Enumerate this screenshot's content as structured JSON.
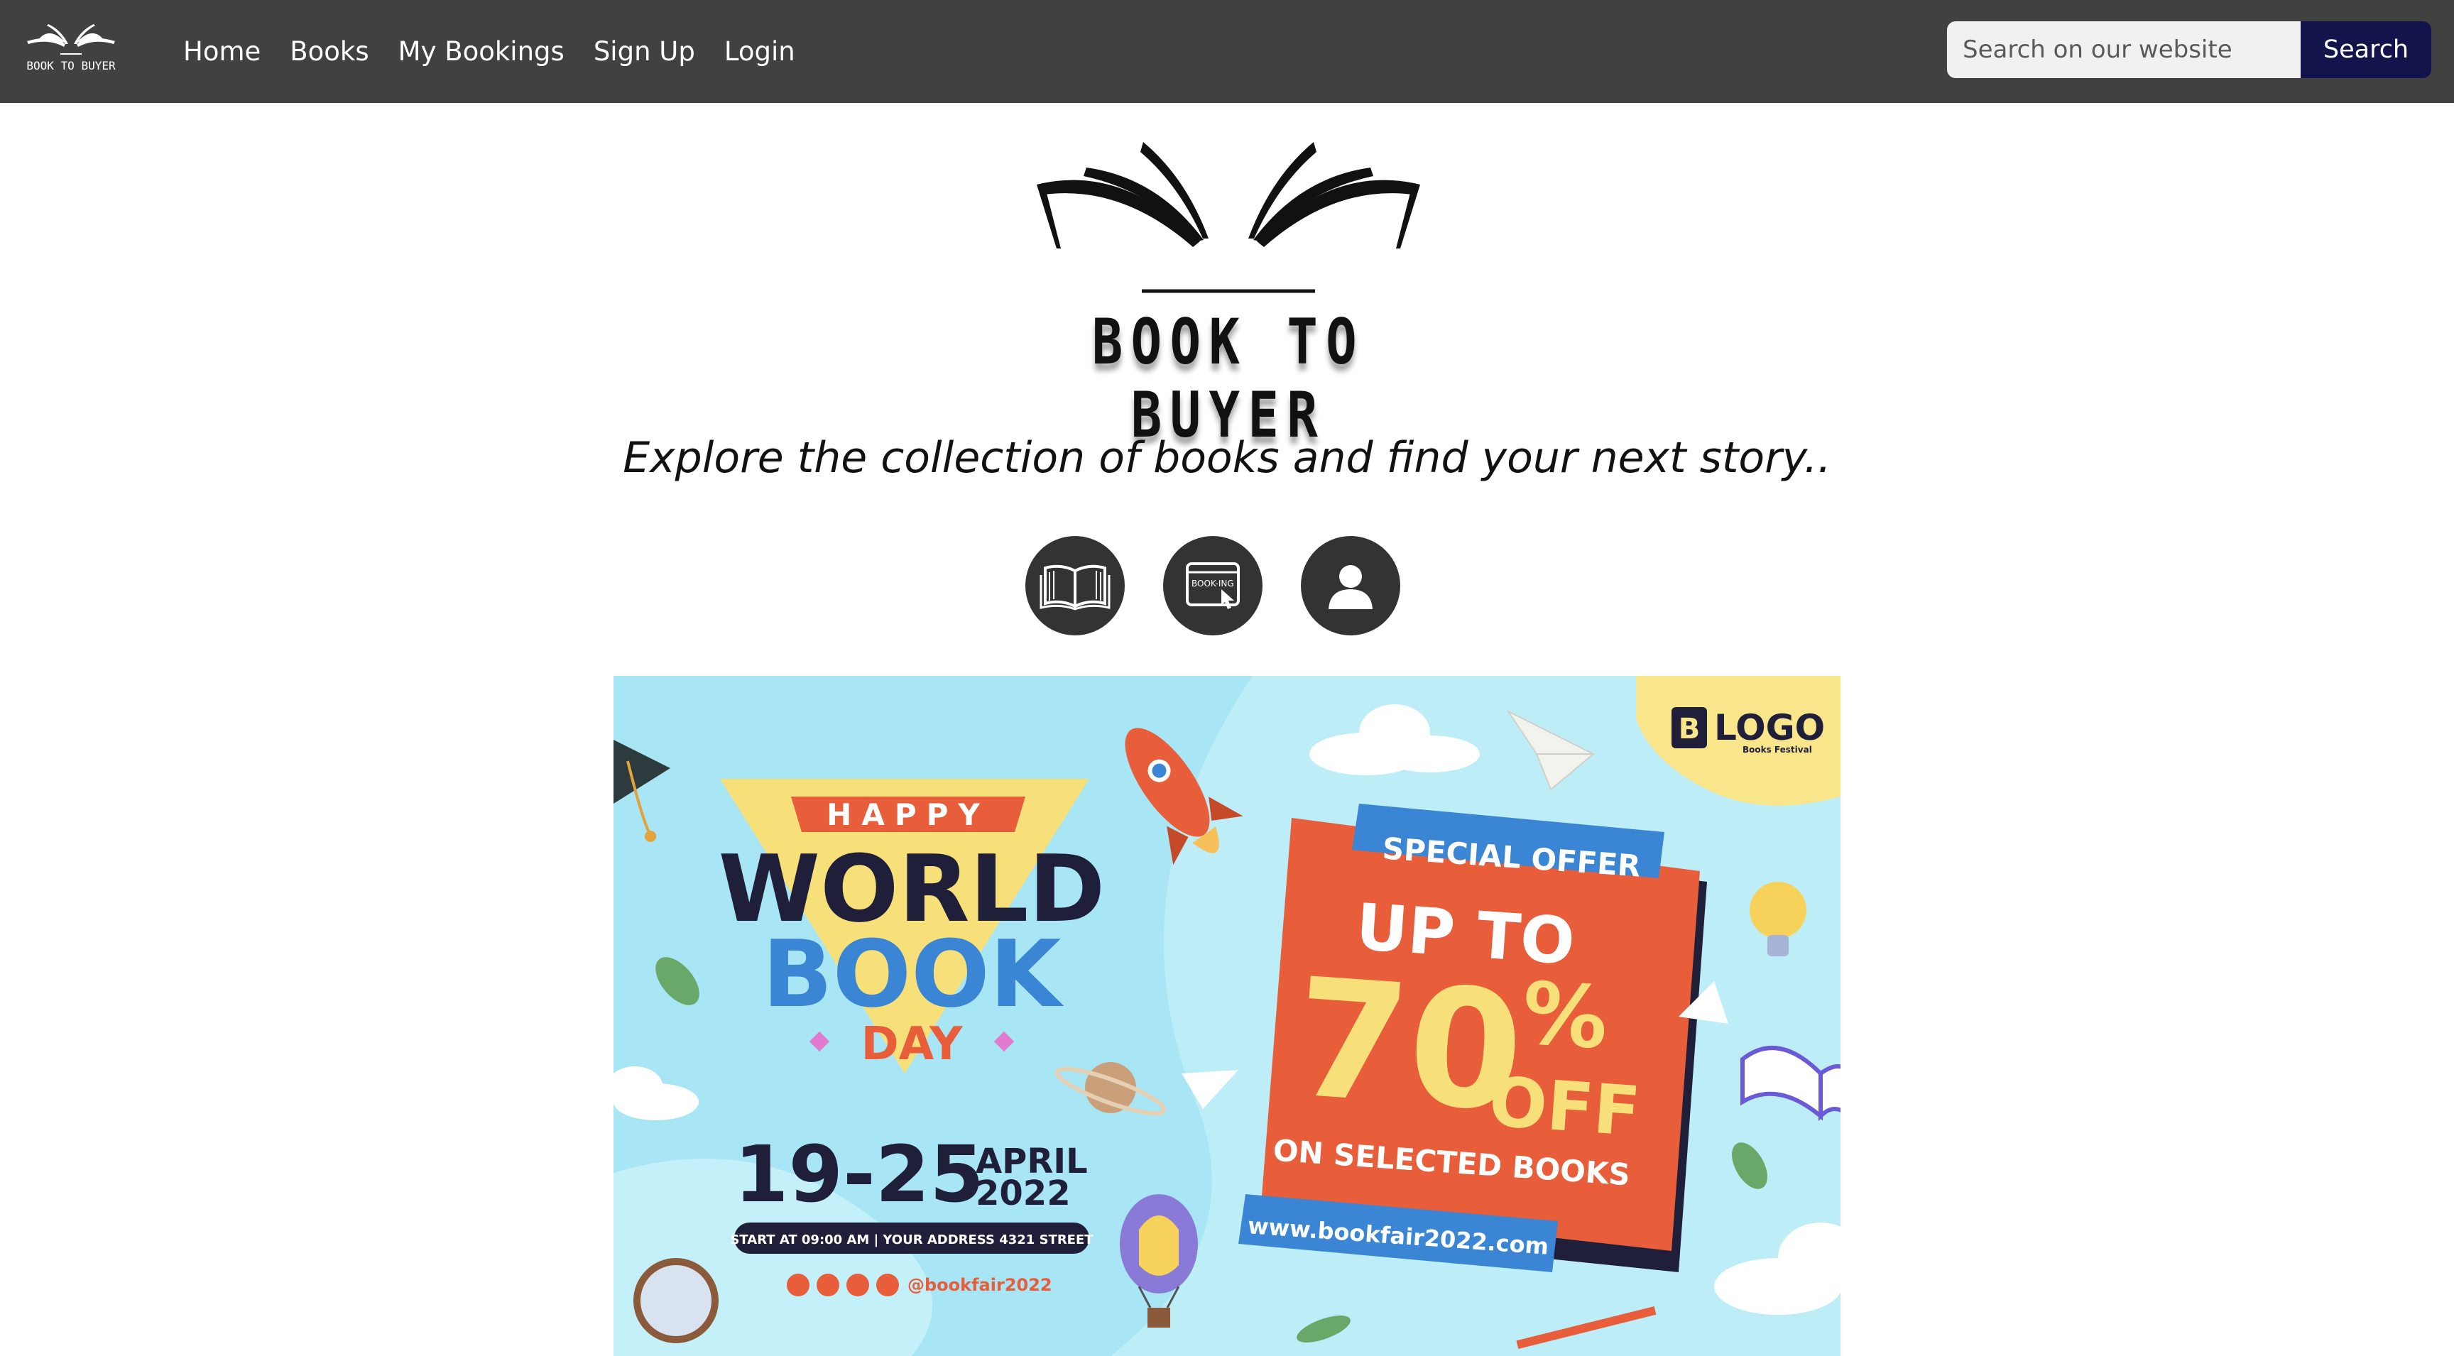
{
  "brand": {
    "name": "BOOK TO BUYER",
    "logo_text": "BOOK TO BUYER"
  },
  "nav": {
    "items": [
      {
        "label": "Home"
      },
      {
        "label": "Books"
      },
      {
        "label": "My Bookings"
      },
      {
        "label": "Sign Up"
      },
      {
        "label": "Login"
      }
    ]
  },
  "search": {
    "placeholder": "Search on our website",
    "value": "",
    "button_label": "Search"
  },
  "hero": {
    "tagline": "Explore the collection of books and find your next story..",
    "icons": [
      {
        "name": "open-book-icon"
      },
      {
        "name": "booking-icon",
        "text": "BOOK-ING"
      },
      {
        "name": "user-icon"
      }
    ]
  },
  "banner": {
    "logo": "LOGO",
    "logo_sub": "Books Festival",
    "happy": "HAPPY",
    "world": "WORLD",
    "book": "BOOK",
    "day": "DAY",
    "date_range": "19-25",
    "month": "APRIL",
    "year": "2022",
    "details": "START AT 09:00 AM  |  YOUR ADDRESS 4321 STREET",
    "handle": "@bookfair2022",
    "special_offer": "SPECIAL OFFER",
    "up_to": "UP TO",
    "percent": "70",
    "percent_sign": "%",
    "off": "OFF",
    "selected": "ON SELECTED BOOKS",
    "url": "www.bookfair2022.com",
    "colors": {
      "sky": "#a8e6f5",
      "orange": "#e85d3a",
      "blue": "#3a86d4",
      "navy": "#1f1f3a",
      "yellow": "#f7e07a"
    }
  }
}
